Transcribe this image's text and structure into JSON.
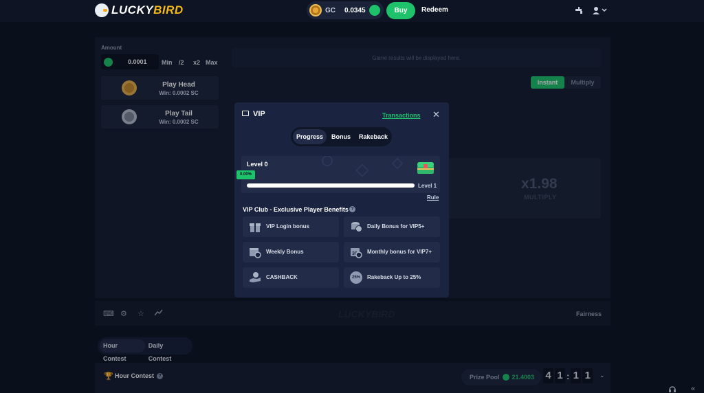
{
  "header": {
    "logo_text_a": "LUCKY",
    "logo_text_b": "BIRD",
    "currency": "GC",
    "balance": "0.0345",
    "buy_label": "Buy",
    "redeem_label": "Redeem"
  },
  "bet": {
    "amount_label": "Amount",
    "amount_value": "0.0001",
    "buttons": [
      "Min",
      "/2",
      "x2",
      "Max"
    ],
    "play_head": {
      "title": "Play Head",
      "sub": "Win: 0.0002 SC"
    },
    "play_tail": {
      "title": "Play Tail",
      "sub": "Win: 0.0002 SC"
    }
  },
  "game": {
    "results_placeholder": "Game results will be displayed here.",
    "mode_instant": "Instant",
    "mode_multiply": "Multiply",
    "multiplier": "x1.98",
    "multiplier_label": "MULTIPLY"
  },
  "toolbar": {
    "logo": "LUCKYBIRD",
    "fairness": "Fairness"
  },
  "contest": {
    "tab_hour": "Hour Contest",
    "tab_daily": "Daily Contest",
    "title": "Hour Contest",
    "prize_label": "Prize Pool",
    "prize_value": "21.4003",
    "timer": [
      "4",
      "1",
      "1",
      "1"
    ]
  },
  "vip_modal": {
    "title": "VIP",
    "transactions": "Transactions",
    "tabs": [
      "Progress",
      "Bonus",
      "Rakeback"
    ],
    "level": "Level 0",
    "progress_text": "0.00%",
    "progress_fraction": 0.0,
    "next_level": "Level 1",
    "rule": "Rule",
    "benefits_title": "VIP Club - Exclusive Player Benefits",
    "benefits": [
      {
        "label": "VIP Login bonus",
        "icon": "gift-icon"
      },
      {
        "label": "Daily Bonus for VIP5+",
        "icon": "coins-icon"
      },
      {
        "label": "Weekly Bonus",
        "icon": "calendar-clock-icon"
      },
      {
        "label": "Monthly bonus for VIP7+",
        "icon": "calendar-30-icon"
      },
      {
        "label": "CASHBACK",
        "icon": "hand-coin-icon"
      },
      {
        "label": "Rakeback Up to 25%",
        "icon": "percent-badge-icon",
        "badge": "25%"
      }
    ]
  },
  "colors": {
    "accent": "#1ec26a",
    "background": "#0d1322",
    "modal": "#1a2340"
  }
}
